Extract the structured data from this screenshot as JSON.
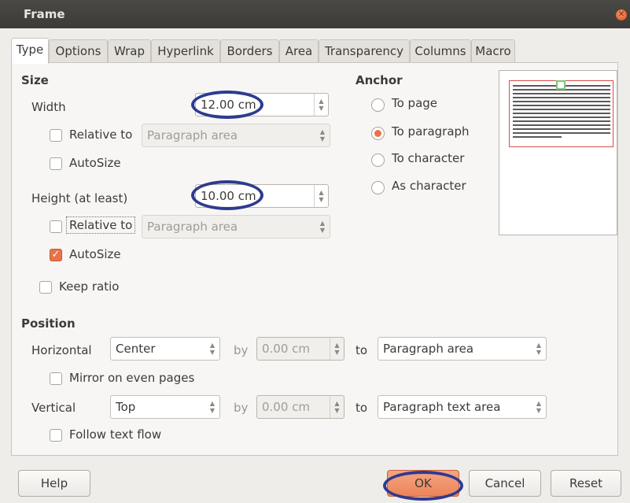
{
  "window": {
    "title": "Frame",
    "close_icon": "close-icon"
  },
  "tabs": [
    {
      "label": "Type",
      "active": true
    },
    {
      "label": "Options"
    },
    {
      "label": "Wrap"
    },
    {
      "label": "Hyperlink"
    },
    {
      "label": "Borders"
    },
    {
      "label": "Area"
    },
    {
      "label": "Transparency"
    },
    {
      "label": "Columns"
    },
    {
      "label": "Macro"
    }
  ],
  "size": {
    "heading": "Size",
    "width_label": "Width",
    "width_value": "12.00 cm",
    "width_relative_label": "Relative to",
    "width_relative_value": "Paragraph area",
    "width_autosize_label": "AutoSize",
    "height_label": "Height (at least)",
    "height_value": "10.00 cm",
    "height_relative_label": "Relative to",
    "height_relative_value": "Paragraph area",
    "height_autosize_label": "AutoSize",
    "keep_ratio_label": "Keep ratio"
  },
  "anchor": {
    "heading": "Anchor",
    "options": [
      "To page",
      "To paragraph",
      "To character",
      "As character"
    ],
    "selected": "To paragraph"
  },
  "position": {
    "heading": "Position",
    "horizontal_label": "Horizontal",
    "horizontal_value": "Center",
    "h_by_label": "by",
    "h_by_value": "0.00 cm",
    "h_to_label": "to",
    "h_to_value": "Paragraph area",
    "mirror_label": "Mirror on even pages",
    "vertical_label": "Vertical",
    "vertical_value": "Top",
    "v_by_label": "by",
    "v_by_value": "0.00 cm",
    "v_to_label": "to",
    "v_to_value": "Paragraph text area",
    "follow_label": "Follow text flow"
  },
  "buttons": {
    "help": "Help",
    "ok": "OK",
    "cancel": "Cancel",
    "reset": "Reset"
  },
  "colors": {
    "accent": "#e8734a",
    "annotation": "#2e3b8f",
    "titlebar": "#3c3b37"
  }
}
